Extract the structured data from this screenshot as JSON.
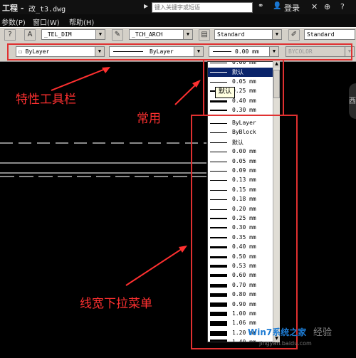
{
  "titlebar": {
    "title": "工程 - ",
    "file": "改_t3.dwg",
    "search_placeholder": "键入关键字或短语",
    "login": "登录"
  },
  "menu": [
    "参数(P)",
    "窗口(W)",
    "帮助(H)"
  ],
  "toolbar1": {
    "dimstyle": "_TEL_DIM",
    "arch": "_TCH_ARCH",
    "textstyle": "Standard",
    "tablestyle": "Standard"
  },
  "properties": {
    "color": "ByLayer",
    "linetype": "ByLayer",
    "lineweight": "0.00 mm",
    "plotstyle": "BYCOLOR"
  },
  "tooltip": "默认",
  "side_label": "西",
  "dropdown": {
    "common": [
      {
        "label": "0.00 mm",
        "w": 1
      },
      {
        "label": "默认",
        "w": 1,
        "selected": true
      },
      {
        "label": "0.05 mm",
        "w": 1
      },
      {
        "label": "0.25 mm",
        "w": 2
      },
      {
        "label": "0.40 mm",
        "w": 3
      },
      {
        "label": "0.30 mm",
        "w": 2
      }
    ],
    "all": [
      {
        "label": "ByLayer",
        "w": 1
      },
      {
        "label": "ByBlock",
        "w": 1
      },
      {
        "label": "默认",
        "w": 1
      },
      {
        "label": "0.00 mm",
        "w": 1
      },
      {
        "label": "0.05 mm",
        "w": 1
      },
      {
        "label": "0.09 mm",
        "w": 1
      },
      {
        "label": "0.13 mm",
        "w": 1
      },
      {
        "label": "0.15 mm",
        "w": 1
      },
      {
        "label": "0.18 mm",
        "w": 1
      },
      {
        "label": "0.20 mm",
        "w": 1
      },
      {
        "label": "0.25 mm",
        "w": 2
      },
      {
        "label": "0.30 mm",
        "w": 2
      },
      {
        "label": "0.35 mm",
        "w": 2
      },
      {
        "label": "0.40 mm",
        "w": 3
      },
      {
        "label": "0.50 mm",
        "w": 3
      },
      {
        "label": "0.53 mm",
        "w": 4
      },
      {
        "label": "0.60 mm",
        "w": 4
      },
      {
        "label": "0.70 mm",
        "w": 5
      },
      {
        "label": "0.80 mm",
        "w": 5
      },
      {
        "label": "0.90 mm",
        "w": 6
      },
      {
        "label": "1.00 mm",
        "w": 6
      },
      {
        "label": "1.06 mm",
        "w": 7
      },
      {
        "label": "1.20 mm",
        "w": 7
      },
      {
        "label": "1.40 mm",
        "w": 8
      }
    ]
  },
  "annotations": {
    "toolbar": "特性工具栏",
    "common": "常用",
    "dropdown": "线宽下拉菜单"
  },
  "watermark": {
    "brand": "Win7系统之家",
    "jingyan": "经验",
    "url": "jingyan.baidu.com"
  },
  "colors": {
    "annotation_red": "#ff3030",
    "selection": "#0a246a"
  }
}
